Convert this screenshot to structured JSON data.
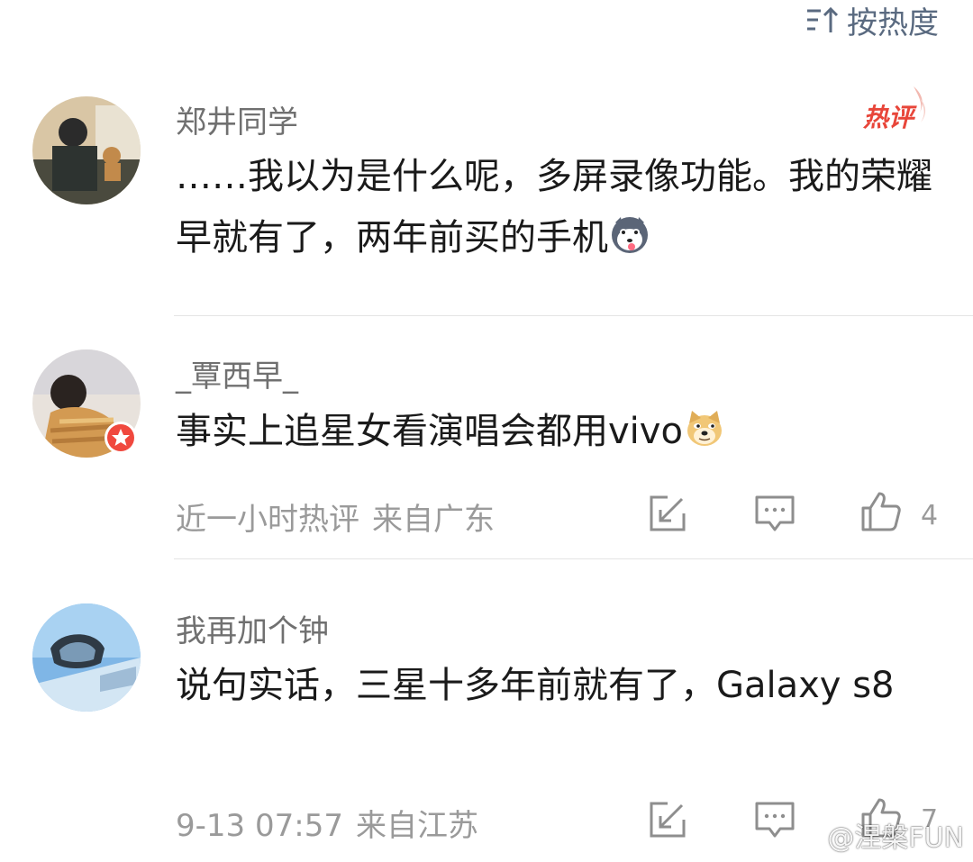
{
  "sort": {
    "label": "按热度",
    "icon": "sort-icon"
  },
  "colors": {
    "username": "#707070",
    "body_text": "#1a1a1a",
    "meta_text": "#9a9a9a",
    "hot_badge": "#e8463a",
    "divider": "#e4e4e4",
    "sort_text": "#5a6a80"
  },
  "comments": [
    {
      "username": "郑井同学",
      "badge": "热评",
      "text": "……我以为是什么呢，多屏录像功能。我的荣耀早就有了，两年前买的手机",
      "emoji": "husky-emoji"
    },
    {
      "username": "_覃西早_",
      "avatar_badge": "star-badge-icon",
      "text": "事实上追星女看演唱会都用vivo",
      "emoji": "doge-emoji",
      "meta": {
        "time": "近一小时热评",
        "location": "来自广东"
      },
      "likes": "4"
    },
    {
      "username": "我再加个钟",
      "text": "说句实话，三星十多年前就有了，Galaxy s8",
      "meta": {
        "time": "9-13 07:57",
        "location": "来自江苏"
      },
      "likes": "7"
    }
  ],
  "watermark": {
    "text": "@涅槃FUN",
    "icon": "weibo-icon"
  }
}
